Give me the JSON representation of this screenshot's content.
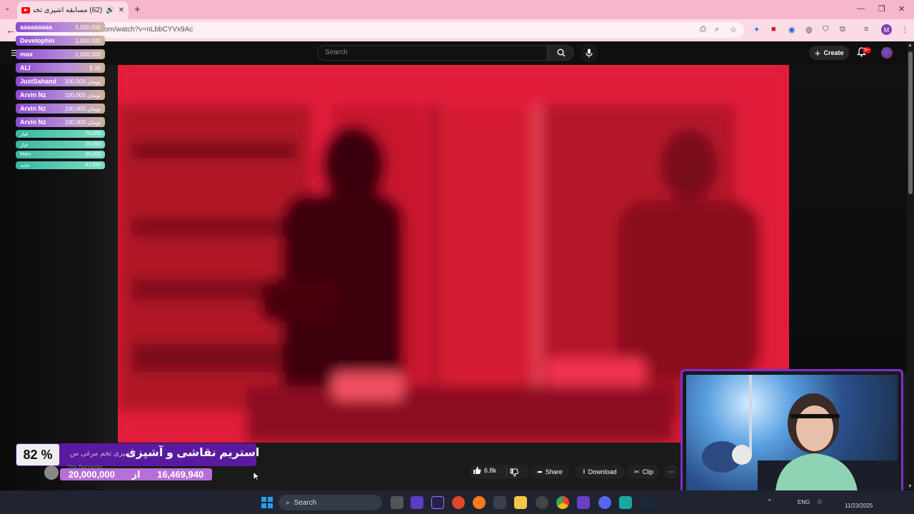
{
  "browser": {
    "tab_title": "(62) مسابقه آشپزی تخم مرغ...",
    "tab_count_badge": "",
    "url": "om/watch?v=nLbbCYVx9Ac",
    "new_tab": "+",
    "profile_letter": "M",
    "window_controls": [
      "—",
      "❐",
      "✕"
    ]
  },
  "youtube": {
    "search_placeholder": "Search",
    "create_label": "Create",
    "notifications": "9+"
  },
  "donations": [
    {
      "name": "aaaaaaaaa",
      "amount": "5,000,000",
      "style": "purple"
    },
    {
      "name": "Develophin",
      "amount": "1,000,000",
      "style": "purple"
    },
    {
      "name": "max",
      "amount": "1,000,000",
      "style": "purple"
    },
    {
      "name": "ALI",
      "amount": "$ 20",
      "style": "purple"
    },
    {
      "name": "JustSahand",
      "amount": "100,000 تومان",
      "style": "purple"
    },
    {
      "name": "Arvin Nz",
      "amount": "100,000 تومان",
      "style": "purple"
    },
    {
      "name": "Arvin Nz",
      "amount": "100,000 تومان",
      "style": "purple"
    },
    {
      "name": "Arvin Nz",
      "amount": "100,000 تومان",
      "style": "purple"
    },
    {
      "name": "قیاز",
      "amount": "70,000",
      "style": "teal"
    },
    {
      "name": "قیاز",
      "amount": "20,000",
      "style": "teal"
    },
    {
      "name": "Mani",
      "amount": "55,000",
      "style": "teal"
    },
    {
      "name": "حامد",
      "amount": "87,654",
      "style": "teal"
    }
  ],
  "actions": {
    "likes": "6.8k",
    "share": "Share",
    "download": "Download",
    "clip": "Clip",
    "more": "⋯"
  },
  "goal": {
    "percent": "82 %",
    "title": "استریم نقاشی و آشپزی",
    "subtitle": "آشپزی تخم مرغی س",
    "target": "20,000,000",
    "separator": "از",
    "current": "16,469,940",
    "channel": "The Benjamin"
  },
  "taskbar": {
    "search_label": "Search",
    "language": "ENG",
    "date": "11/23/2025"
  }
}
